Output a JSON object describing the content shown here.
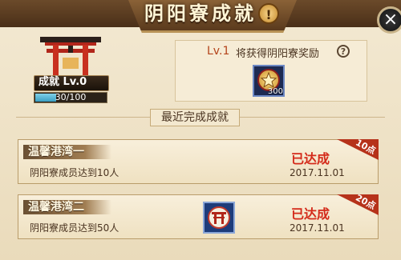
{
  "window": {
    "title": "阴阳寮成就",
    "title_badge": "!",
    "close_symbol": "×"
  },
  "achievement": {
    "level_label": "成就 Lv.0",
    "progress_text": "30/100",
    "progress_fraction": 0.3,
    "icon": "torii-gate-icon"
  },
  "reward": {
    "level": "Lv.1",
    "description": "将获得阴阳寮奖励",
    "help_symbol": "?",
    "item_icon": "star-medal-icon",
    "item_count": "300"
  },
  "section": {
    "title": "最近完成成就"
  },
  "cards": [
    {
      "title": "温馨港湾一",
      "description": "阴阳寮成员达到10人",
      "status": "已达成",
      "date": "2017.11.01",
      "points": "10点",
      "has_item": false
    },
    {
      "title": "温馨港湾二",
      "description": "阴阳寮成员达到50人",
      "status": "已达成",
      "date": "2017.11.01",
      "points": "20点",
      "has_item": true,
      "item_icon": "torii-badge-icon"
    }
  ],
  "colors": {
    "status_red": "#d42a1a",
    "accent_brown": "#6b4a2a",
    "progress_blue": "#3b9fc2"
  }
}
